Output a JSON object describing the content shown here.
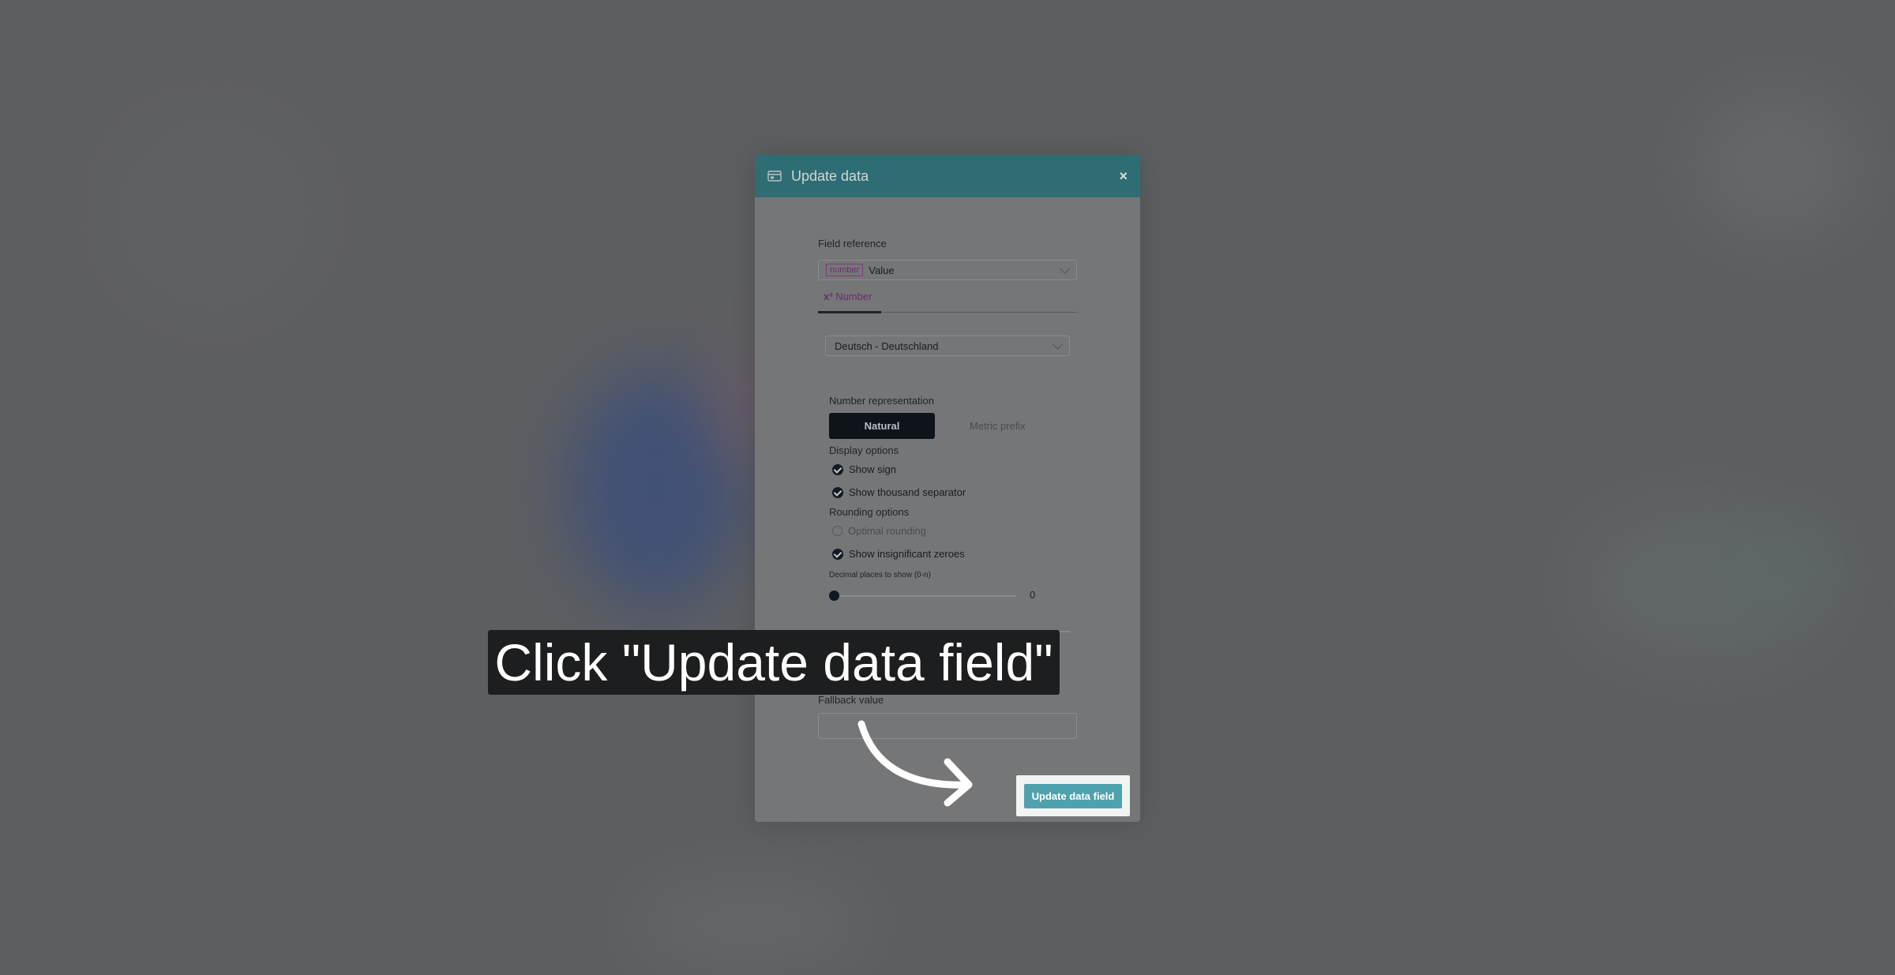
{
  "modal": {
    "title": "Update data",
    "close_glyph": "×",
    "field_reference": {
      "label": "Field reference",
      "type_tag": "number",
      "value": "Value"
    },
    "tab": {
      "icon": "x²",
      "label": "Number"
    },
    "locale": "Deutsch - Deutschland",
    "number_representation": {
      "label": "Number representation",
      "options": [
        "Natural",
        "Metric prefix"
      ],
      "selected": "Natural"
    },
    "display_options": {
      "label": "Display options",
      "items": [
        {
          "label": "Show sign",
          "checked": true
        },
        {
          "label": "Show thousand separator",
          "checked": true
        }
      ]
    },
    "rounding_options": {
      "label": "Rounding options",
      "items": [
        {
          "label": "Optimal rounding",
          "checked": false
        },
        {
          "label": "Show insignificant zeroes",
          "checked": true
        }
      ]
    },
    "decimal_places": {
      "label": "Decimal places to show (0-n)",
      "value": "0"
    },
    "fallback": {
      "label": "Fallback value",
      "value": ""
    },
    "submit_label": "Update data field"
  },
  "overlay": {
    "caption": "Click \"Update data field\""
  },
  "colors": {
    "header": "#2f6d74",
    "accent_button": "#4fa1ae",
    "selected_toggle": "#0f141b",
    "type_tag": "#7b3a79"
  }
}
